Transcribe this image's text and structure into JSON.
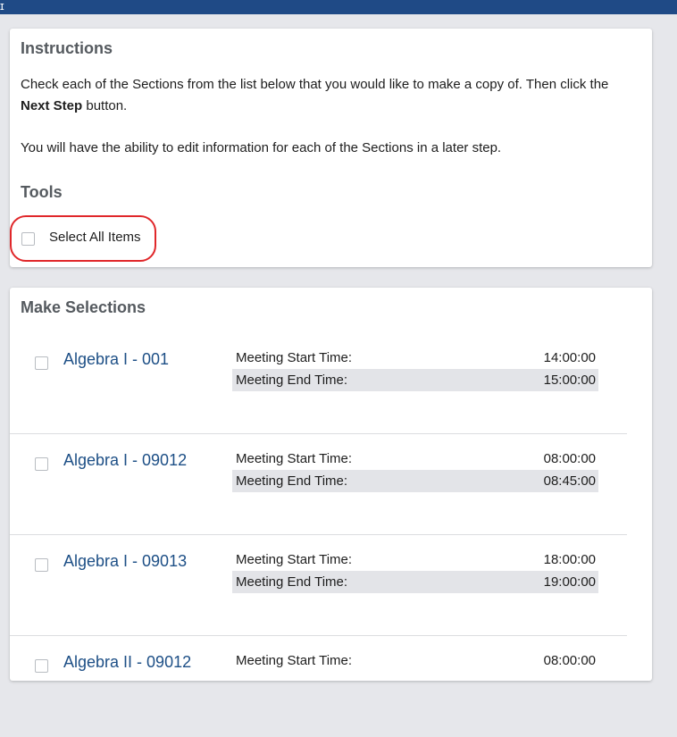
{
  "topbar": {
    "glyph": "ɪ",
    "color": "#1f4a86"
  },
  "instructions": {
    "heading": "Instructions",
    "text_part1": "Check each of the Sections from the list below that you would like to make a copy of. Then click the ",
    "next_step_bold": "Next Step",
    "text_part2": " button.",
    "paragraph2": "You will have the ability to edit information for each of the Sections in a later step."
  },
  "tools": {
    "heading": "Tools",
    "select_all_label": "Select All Items",
    "highlight_color": "#e0272a"
  },
  "selections": {
    "heading": "Make Selections",
    "start_label": "Meeting Start Time:",
    "end_label": "Meeting End Time:",
    "items": [
      {
        "name": "Algebra I - 001",
        "start": "14:00:00",
        "end": "15:00:00"
      },
      {
        "name": "Algebra I - 09012",
        "start": "08:00:00",
        "end": "08:45:00"
      },
      {
        "name": "Algebra I - 09013",
        "start": "18:00:00",
        "end": "19:00:00"
      },
      {
        "name": "Algebra II - 09012",
        "start": "08:00:00",
        "end": ""
      }
    ]
  },
  "colors": {
    "link": "#1d4f86",
    "heading": "#555a5f",
    "page_background": "#e6e7eb"
  }
}
